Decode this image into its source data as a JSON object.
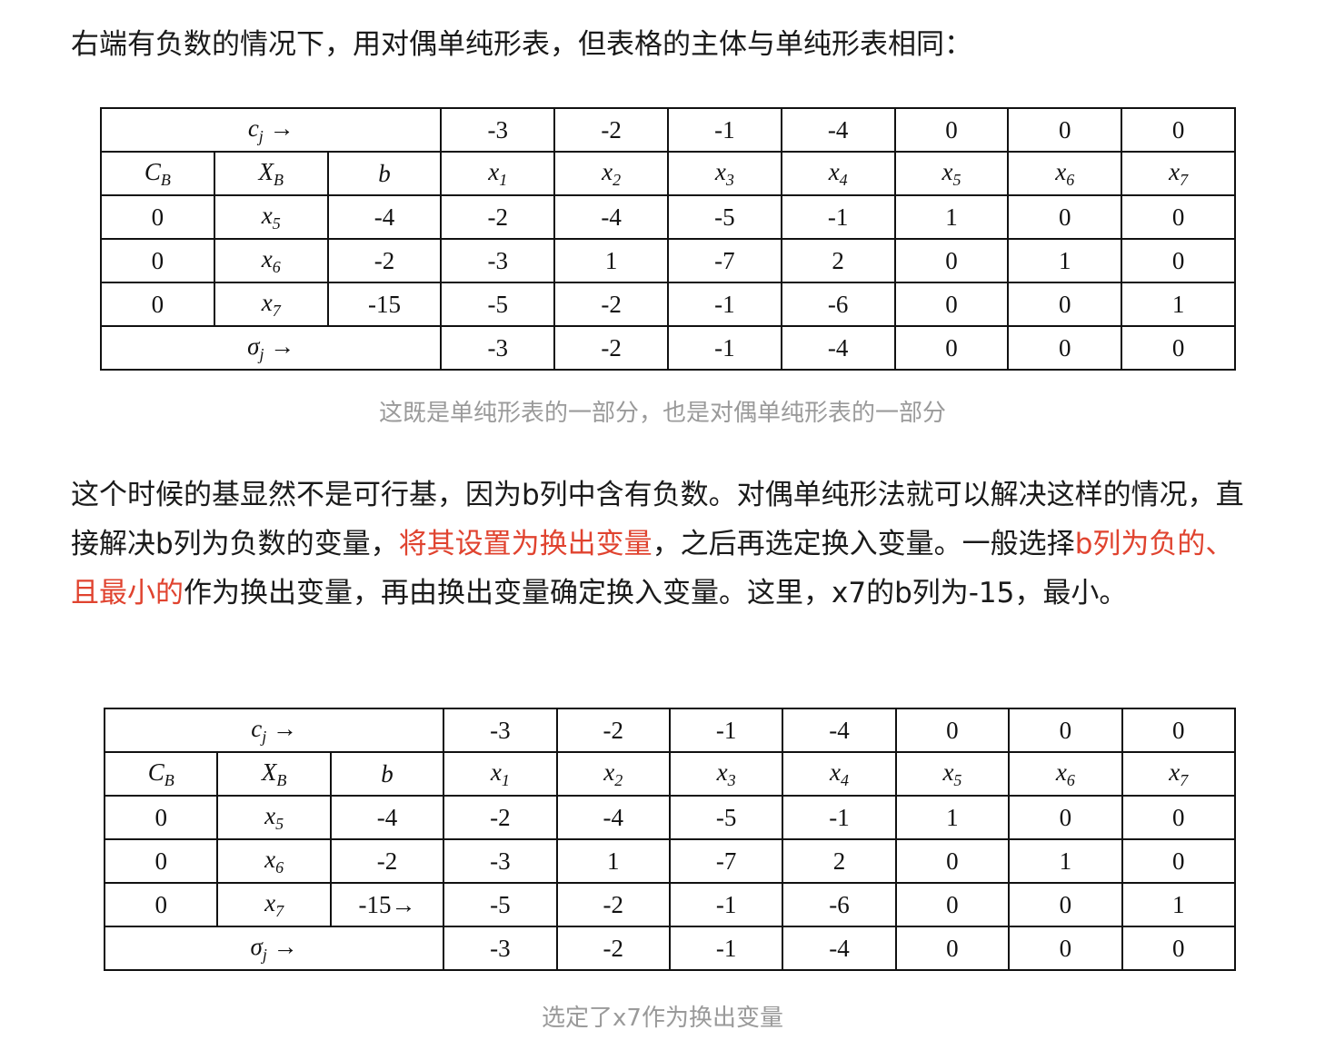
{
  "intro_text": "右端有负数的情况下，用对偶单纯形表，但表格的主体与单纯形表相同：",
  "table1": {
    "cj_label": "c",
    "cj_sub": "j",
    "arrow": "→",
    "cj_values": [
      "-3",
      "-2",
      "-1",
      "-4",
      "0",
      "0",
      "0"
    ],
    "header": {
      "cb": "C",
      "cb_sub": "B",
      "xb": "X",
      "xb_sub": "B",
      "b": "b"
    },
    "var_headers": [
      {
        "name": "x",
        "sub": "1"
      },
      {
        "name": "x",
        "sub": "2"
      },
      {
        "name": "x",
        "sub": "3"
      },
      {
        "name": "x",
        "sub": "4"
      },
      {
        "name": "x",
        "sub": "5"
      },
      {
        "name": "x",
        "sub": "6"
      },
      {
        "name": "x",
        "sub": "7"
      }
    ],
    "rows": [
      {
        "cb": "0",
        "xb": "x",
        "xb_sub": "5",
        "b": "-4",
        "values": [
          "-2",
          "-4",
          "-5",
          "-1",
          "1",
          "0",
          "0"
        ]
      },
      {
        "cb": "0",
        "xb": "x",
        "xb_sub": "6",
        "b": "-2",
        "values": [
          "-3",
          "1",
          "-7",
          "2",
          "0",
          "1",
          "0"
        ]
      },
      {
        "cb": "0",
        "xb": "x",
        "xb_sub": "7",
        "b": "-15",
        "values": [
          "-5",
          "-2",
          "-1",
          "-6",
          "0",
          "0",
          "1"
        ]
      }
    ],
    "sigma_label": "σ",
    "sigma_sub": "j",
    "sigma_values": [
      "-3",
      "-2",
      "-1",
      "-4",
      "0",
      "0",
      "0"
    ]
  },
  "caption1": "这既是单纯形表的一部分，也是对偶单纯形表的一部分",
  "para2": {
    "part1": "这个时候的基显然不是可行基，因为b列中含有负数。对偶单纯形法就可以解决这样的情况，直接解决b列为负数的变量，",
    "red1": "将其设置为换出变量",
    "part2": "，之后再选定换入变量。一般选择",
    "red2": "b列为负的、且最小的",
    "part3": "作为换出变量，再由换出变量确定换入变量。这里，x7的b列为-15，最小。"
  },
  "table2": {
    "cj_label": "c",
    "cj_sub": "j",
    "arrow": "→",
    "cj_values": [
      "-3",
      "-2",
      "-1",
      "-4",
      "0",
      "0",
      "0"
    ],
    "header": {
      "cb": "C",
      "cb_sub": "B",
      "xb": "X",
      "xb_sub": "B",
      "b": "b"
    },
    "var_headers": [
      {
        "name": "x",
        "sub": "1"
      },
      {
        "name": "x",
        "sub": "2"
      },
      {
        "name": "x",
        "sub": "3"
      },
      {
        "name": "x",
        "sub": "4"
      },
      {
        "name": "x",
        "sub": "5"
      },
      {
        "name": "x",
        "sub": "6"
      },
      {
        "name": "x",
        "sub": "7"
      }
    ],
    "rows": [
      {
        "cb": "0",
        "xb": "x",
        "xb_sub": "5",
        "b": "-4",
        "values": [
          "-2",
          "-4",
          "-5",
          "-1",
          "1",
          "0",
          "0"
        ]
      },
      {
        "cb": "0",
        "xb": "x",
        "xb_sub": "6",
        "b": "-2",
        "values": [
          "-3",
          "1",
          "-7",
          "2",
          "0",
          "1",
          "0"
        ]
      },
      {
        "cb": "0",
        "xb": "x",
        "xb_sub": "7",
        "b": "-15→",
        "values": [
          "-5",
          "-2",
          "-1",
          "-6",
          "0",
          "0",
          "1"
        ]
      }
    ],
    "sigma_label": "σ",
    "sigma_sub": "j",
    "sigma_values": [
      "-3",
      "-2",
      "-1",
      "-4",
      "0",
      "0",
      "0"
    ]
  },
  "caption2": "选定了x7作为换出变量"
}
